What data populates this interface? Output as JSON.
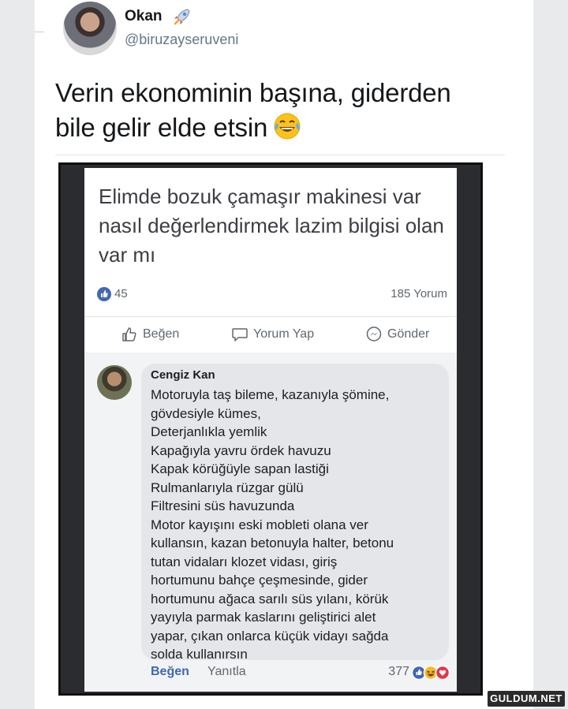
{
  "tweet": {
    "author_name": "Okan",
    "author_handle": "@biruzayseruveni",
    "text": "Verin ekonominin başına, giderden bile gelir elde etsin",
    "name_icon": "rocket-icon",
    "text_emoji": "face-with-tears-of-joy-icon"
  },
  "post": {
    "text": "Elimde  bozuk çamaşır makinesi var  nasıl değerlendirmek lazim bilgisi olan var mı",
    "like_count": "45",
    "comment_count": "185 Yorum",
    "actions": {
      "like": "Beğen",
      "comment": "Yorum Yap",
      "share": "Gönder"
    }
  },
  "comment": {
    "author": "Cengiz Kan",
    "text": "Motoruyla taş bileme, kazanıyla şömine,\ngövdesiyle kümes,\nDeterjanlıkla yemlik\nKapağıyla yavru ördek havuzu\nKapak körüğüyle sapan lastiği\nRulmanlarıyla rüzgar gülü\nFiltresini süs havuzunda\nMotor kayışını eski mobleti olana ver\nkullansın, kazan betonuyla halter, betonu\ntutan vidaları klozet vidası, giriş\nhortumunu bahçe çeşmesinde, gider\nhortumunu ağaca sarılı süs yılanı, körük\nyayıyla parmak kaslarını geliştirici alet\nyapar, çıkan onlarca küçük vidayı sağda\nsolda kullanırsın",
    "like_label": "Beğen",
    "reply_label": "Yanıtla",
    "reaction_count": "377"
  },
  "watermark": "GULDUM.NET",
  "colors": {
    "facebook_blue": "#4267b2",
    "heart_red": "#e8334a",
    "haha_yellow": "#f7b928"
  }
}
